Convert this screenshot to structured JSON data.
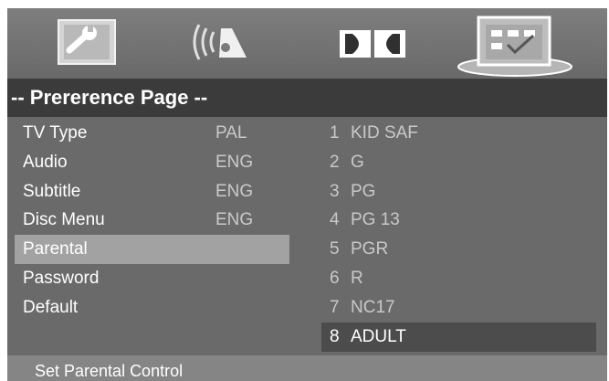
{
  "tabs": [
    {
      "name": "General Setup",
      "icon": "wrench-icon"
    },
    {
      "name": "Audio Setup",
      "icon": "speaker-icon"
    },
    {
      "name": "Dolby Digital Setup",
      "icon": "dolby-icon"
    },
    {
      "name": "Preference Setup",
      "icon": "checklist-icon",
      "active": true
    }
  ],
  "page": {
    "title": "-- Prererence Page --"
  },
  "menu": [
    {
      "label": "TV Type",
      "value": "PAL"
    },
    {
      "label": "Audio",
      "value": "ENG"
    },
    {
      "label": "Subtitle",
      "value": "ENG"
    },
    {
      "label": "Disc Menu",
      "value": "ENG"
    },
    {
      "label": "Parental",
      "value": "",
      "selected": true
    },
    {
      "label": "Password",
      "value": ""
    },
    {
      "label": "Default",
      "value": ""
    }
  ],
  "options": [
    {
      "num": "1",
      "label": "KID SAF"
    },
    {
      "num": "2",
      "label": "G"
    },
    {
      "num": "3",
      "label": "PG"
    },
    {
      "num": "4",
      "label": "PG 13"
    },
    {
      "num": "5",
      "label": "PGR"
    },
    {
      "num": "6",
      "label": "R"
    },
    {
      "num": "7",
      "label": "NC17"
    },
    {
      "num": "8",
      "label": "ADULT",
      "highlighted": true
    }
  ],
  "help": {
    "text": "Set Parental Control"
  },
  "colors": {
    "screen_bg": "#6a6a6a",
    "title_bar": "#3b3b3b",
    "selected_row": "#a2a2a2",
    "highlighted_option": "#4c4c4c",
    "help_bar": "#858585",
    "value_text": "#c9c9c9"
  }
}
